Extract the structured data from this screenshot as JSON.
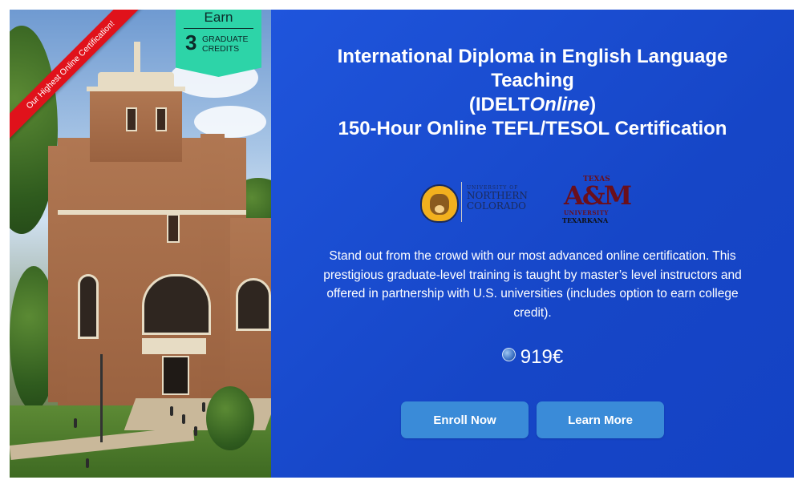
{
  "ribbon": {
    "label": "Our Highest Online Certification!"
  },
  "badge": {
    "earn": "Earn",
    "credits_number": "3",
    "credits_line1": "GRADUATE",
    "credits_line2": "CREDITS"
  },
  "title": {
    "line1": "International Diploma in English Language",
    "line2": "Teaching",
    "line3_prefix": "(IDELT",
    "line3_italic": "Online",
    "line3_suffix": ")",
    "line4": "150-Hour Online TEFL/TESOL Certification"
  },
  "logos": {
    "unc": {
      "small": "UNIVERSITY OF",
      "line1": "NORTHERN",
      "line2": "COLORADO"
    },
    "tamu": {
      "texas": "TEXAS",
      "am": "A&M",
      "university": "UNIVERSITY",
      "city": "TEXARKANA"
    }
  },
  "description": "Stand out from the crowd with our most advanced online certification. This prestigious graduate-level training is taught by master’s level instructors and offered in partnership with U.S. universities (includes option to earn college credit).",
  "price": {
    "value": "919€",
    "icon": "globe-icon"
  },
  "buttons": {
    "enroll": "Enroll Now",
    "learn": "Learn More"
  },
  "colors": {
    "panel": "#1b4fd6",
    "button": "#3a8bd8",
    "badge": "#2dd4a8",
    "ribbon": "#e0121b"
  }
}
